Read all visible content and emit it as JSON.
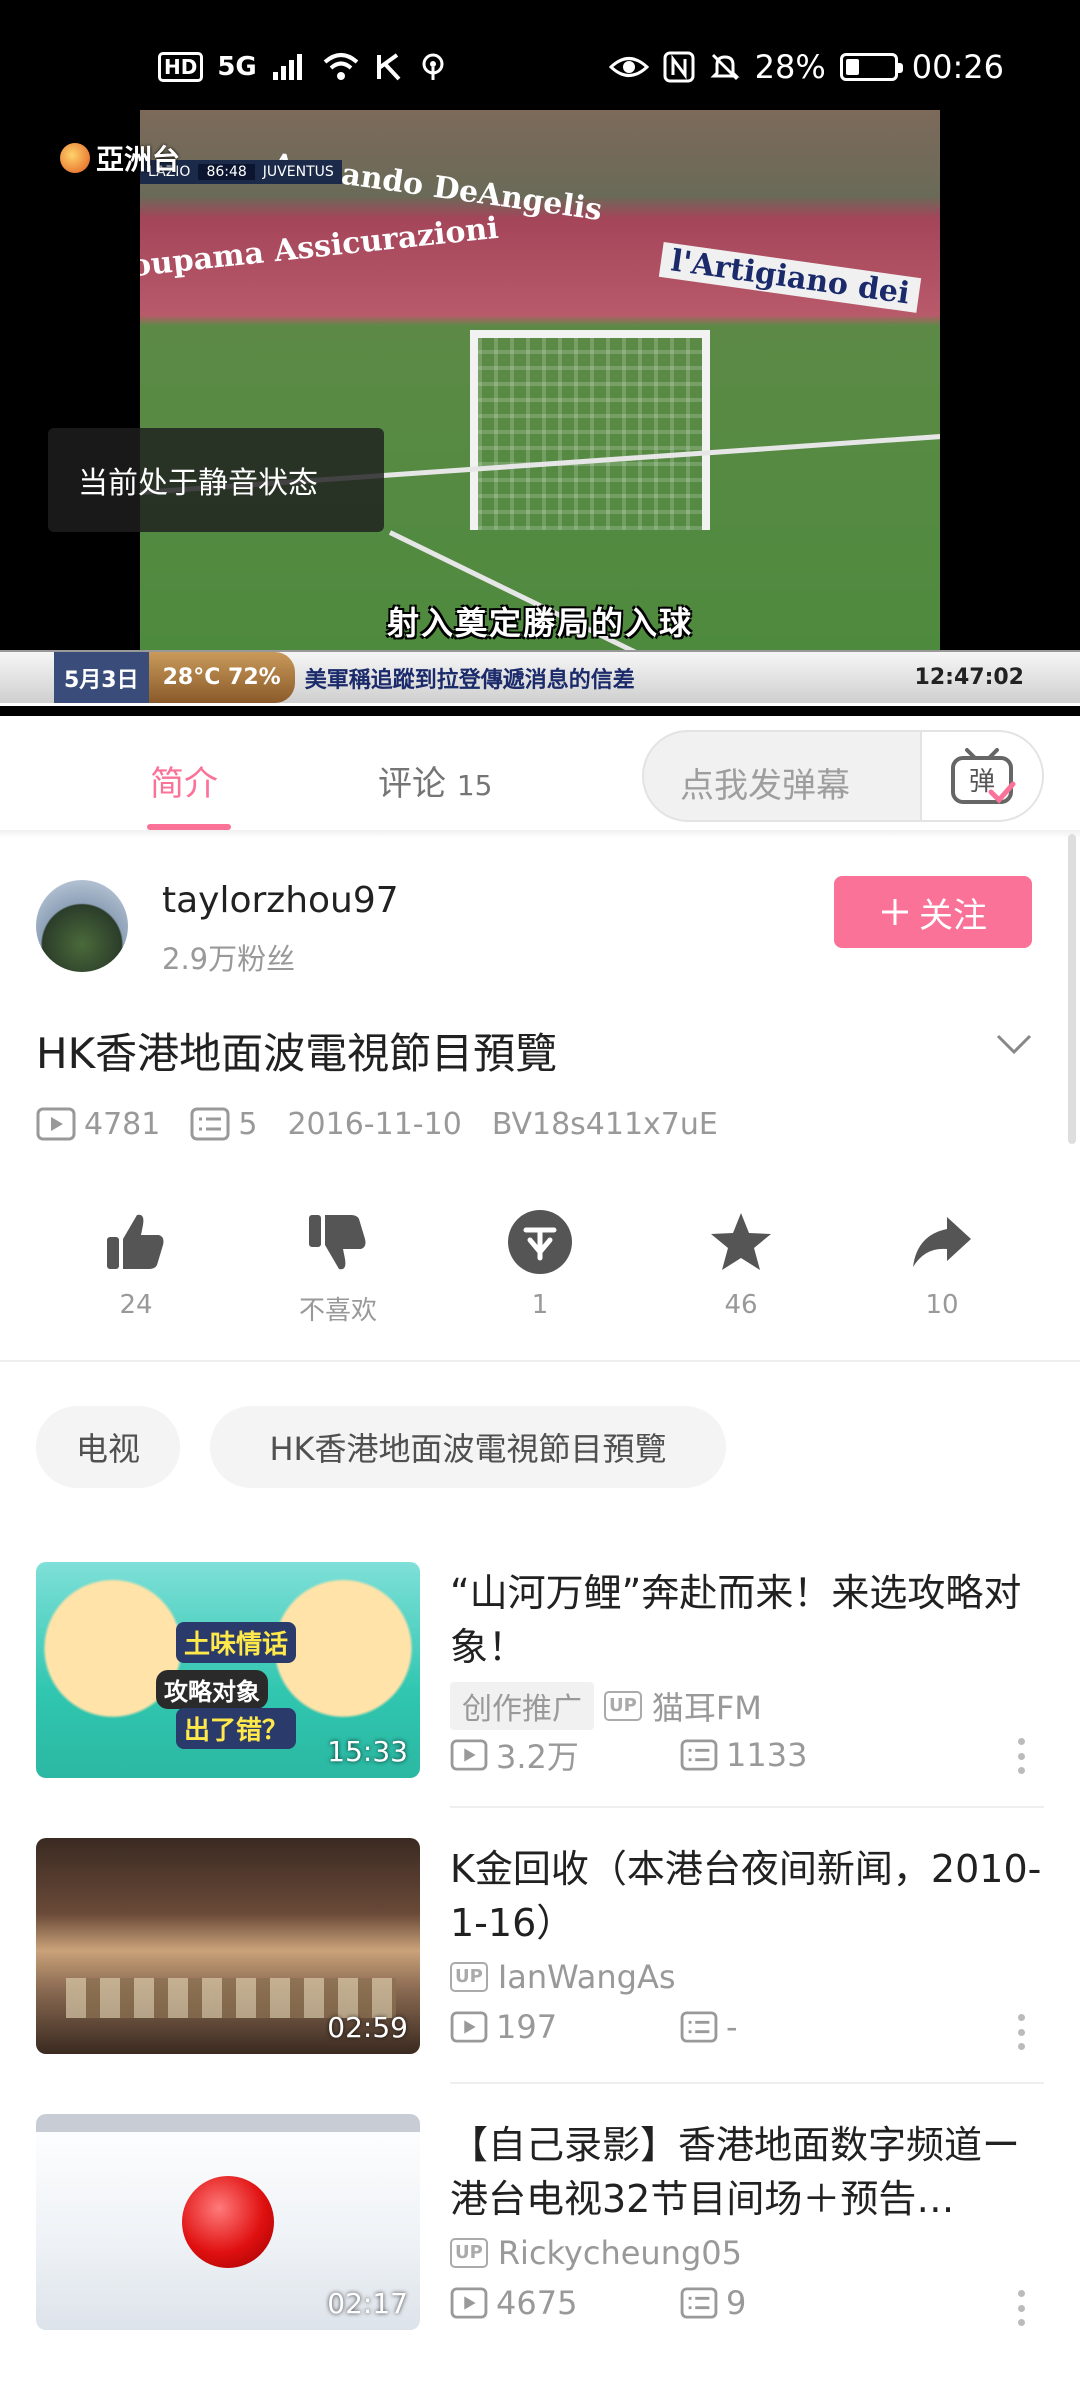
{
  "status_bar": {
    "hd": "HD",
    "network": "5G",
    "nfc": "N",
    "battery_pct": "28%",
    "battery_level": 0.28,
    "time": "00:26"
  },
  "player": {
    "channel_logo": "亞洲台",
    "score_home": "LAZIO",
    "score_time": "86:48",
    "score_away": "JUVENTUS",
    "subtitle": "射入奠定勝局的入球",
    "ticker_date": "5月3日",
    "ticker_weather": "28°C 72%",
    "ticker_news": "美軍稱追蹤到拉登傳遞消息的信差",
    "ticker_clock": "12:47:02",
    "mute_toast": "当前处于静音状态"
  },
  "tabs": {
    "intro": "简介",
    "comments": "评论",
    "comments_count": "15",
    "danmaku_placeholder": "点我发弹幕",
    "danmaku_btn_char": "弹"
  },
  "uploader": {
    "name": "taylorzhou97",
    "fans": "2.9万粉丝",
    "follow_label": "关注"
  },
  "video": {
    "title": "HK香港地面波電視節目預覽",
    "views": "4781",
    "danmaku": "5",
    "date": "2016-11-10",
    "bvid": "BV18s411x7uE"
  },
  "actions": {
    "like": "24",
    "dislike": "不喜欢",
    "coin": "1",
    "favorite": "46",
    "share": "10"
  },
  "tags": [
    "电视",
    "HK香港地面波電視節目預覽"
  ],
  "related": [
    {
      "title": "“山河万鲤”奔赴而来！来选攻略对象！",
      "badge": "创作推广",
      "up": "猫耳FM",
      "views": "3.2万",
      "danmaku": "1133",
      "duration": "15:33"
    },
    {
      "title": "K金回收（本港台夜间新闻，2010-1-16）",
      "up": "IanWangAs",
      "views": "197",
      "danmaku": "-",
      "duration": "02:59"
    },
    {
      "title": "【自己录影】香港地面数字频道ー港台电视32节目间场＋预告…",
      "up": "Rickycheung05",
      "views": "4675",
      "danmaku": "9",
      "duration": "02:17"
    }
  ],
  "up_badge": "UP",
  "colors": {
    "accent": "#fb7299",
    "text_secondary": "#999999"
  }
}
